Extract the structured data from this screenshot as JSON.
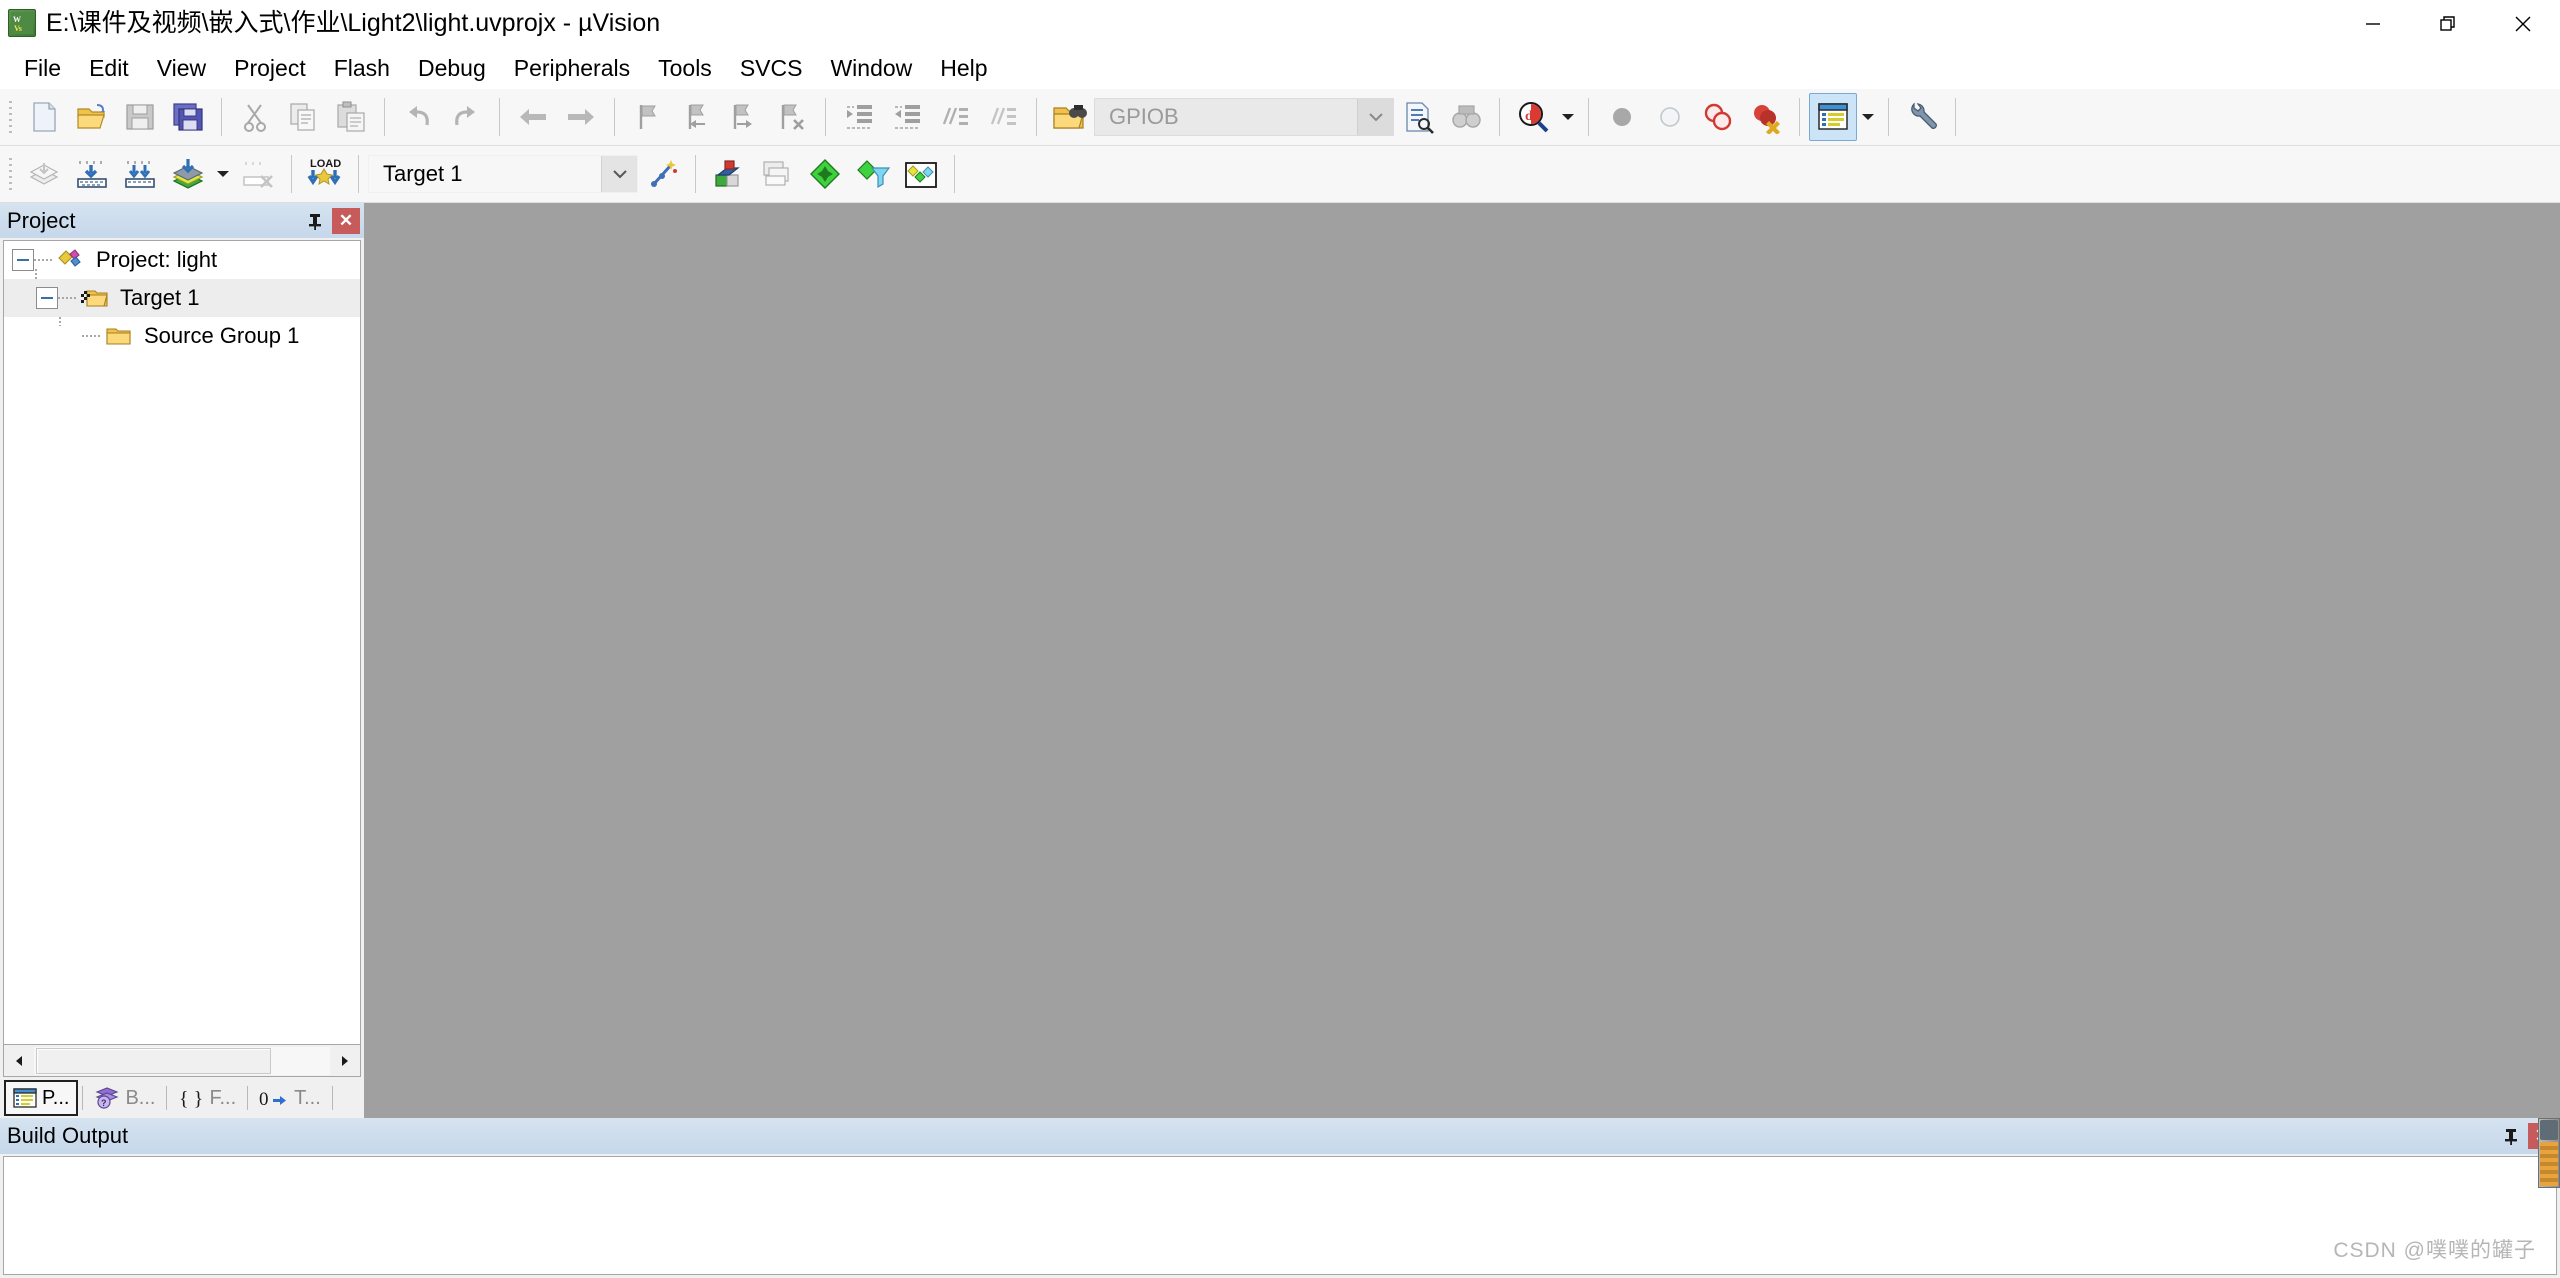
{
  "window": {
    "title": "E:\\课件及视频\\嵌入式\\作业\\Light2\\light.uvprojx - µVision",
    "app_icon": "uvision-logo-icon",
    "controls": {
      "minimize": "minimize-icon",
      "restore": "restore-icon",
      "close": "close-icon"
    },
    "accent_color": "#0072c6"
  },
  "menubar": {
    "items": [
      {
        "label": "File"
      },
      {
        "label": "Edit"
      },
      {
        "label": "View"
      },
      {
        "label": "Project"
      },
      {
        "label": "Flash"
      },
      {
        "label": "Debug"
      },
      {
        "label": "Peripherals"
      },
      {
        "label": "Tools"
      },
      {
        "label": "SVCS"
      },
      {
        "label": "Window"
      },
      {
        "label": "Help"
      }
    ]
  },
  "toolbar_file": {
    "buttons": [
      {
        "name": "new-file-button",
        "icon": "new-file-icon",
        "enabled": true
      },
      {
        "name": "open-file-button",
        "icon": "open-folder-icon",
        "enabled": true
      },
      {
        "name": "save-button",
        "icon": "save-disk-icon",
        "enabled": false
      },
      {
        "name": "save-all-button",
        "icon": "save-all-icon",
        "enabled": true
      },
      {
        "name": "cut-button",
        "icon": "scissors-icon",
        "enabled": false
      },
      {
        "name": "copy-button",
        "icon": "copy-icon",
        "enabled": false
      },
      {
        "name": "paste-button",
        "icon": "paste-icon",
        "enabled": false
      },
      {
        "name": "undo-button",
        "icon": "undo-arrow-icon",
        "enabled": false
      },
      {
        "name": "redo-button",
        "icon": "redo-arrow-icon",
        "enabled": false
      },
      {
        "name": "navigate-backward-button",
        "icon": "arrow-left-icon",
        "enabled": false
      },
      {
        "name": "navigate-forward-button",
        "icon": "arrow-right-icon",
        "enabled": false
      },
      {
        "name": "toggle-bookmark-button",
        "icon": "bookmark-icon",
        "enabled": false
      },
      {
        "name": "previous-bookmark-button",
        "icon": "bookmark-previous-icon",
        "enabled": false
      },
      {
        "name": "next-bookmark-button",
        "icon": "bookmark-next-icon",
        "enabled": false
      },
      {
        "name": "clear-bookmarks-button",
        "icon": "bookmark-clear-icon",
        "enabled": false
      },
      {
        "name": "indent-button",
        "icon": "indent-right-icon",
        "enabled": false
      },
      {
        "name": "outdent-button",
        "icon": "indent-left-icon",
        "enabled": false
      },
      {
        "name": "comment-button",
        "icon": "comment-lines-icon",
        "enabled": false
      },
      {
        "name": "uncomment-button",
        "icon": "uncomment-lines-icon",
        "enabled": false
      },
      {
        "name": "find-in-files-button",
        "icon": "folder-binoculars-icon",
        "enabled": true
      },
      {
        "name": "incremental-find-button",
        "icon": "document-find-icon",
        "enabled": true
      },
      {
        "name": "find-next-button",
        "icon": "binoculars-icon",
        "enabled": false
      },
      {
        "name": "debug-session-button",
        "icon": "debug-magnifier-icon",
        "enabled": true
      },
      {
        "name": "insert-breakpoint-button",
        "icon": "breakpoint-gray-icon",
        "enabled": false
      },
      {
        "name": "enable-breakpoint-button",
        "icon": "breakpoint-hollow-icon",
        "enabled": false
      },
      {
        "name": "disable-all-breakpoints-button",
        "icon": "breakpoints-red-icon",
        "enabled": true
      },
      {
        "name": "kill-all-breakpoints-button",
        "icon": "breakpoint-delete-icon",
        "enabled": true
      },
      {
        "name": "manage-windows-button",
        "icon": "window-layout-icon",
        "enabled": true
      },
      {
        "name": "configuration-wizard-button",
        "icon": "wrench-icon",
        "enabled": true
      }
    ],
    "search": {
      "name": "find-combo",
      "value": "GPIOB",
      "placeholder": "",
      "dropdown_icon": "chevron-down-icon"
    }
  },
  "toolbar_build": {
    "buttons": [
      {
        "name": "translate-file-button",
        "icon": "translate-icon",
        "enabled": false
      },
      {
        "name": "build-target-button",
        "icon": "build-icon",
        "enabled": true
      },
      {
        "name": "rebuild-all-button",
        "icon": "rebuild-all-icon",
        "enabled": true
      },
      {
        "name": "batch-build-button",
        "icon": "batch-build-icon",
        "enabled": true
      },
      {
        "name": "stop-build-button",
        "icon": "stop-build-icon",
        "enabled": false
      },
      {
        "name": "download-button",
        "icon": "load-download-icon",
        "enabled": true
      },
      {
        "name": "target-options-button",
        "icon": "target-options-wand-icon",
        "enabled": true
      },
      {
        "name": "options-for-target-button",
        "icon": "options-target-icon",
        "enabled": true
      },
      {
        "name": "manage-project-items-button",
        "icon": "manage-items-icon",
        "enabled": false
      },
      {
        "name": "pack-installer-button",
        "icon": "green-diamond-icon",
        "enabled": true
      },
      {
        "name": "manage-run-time-environment-button",
        "icon": "funnel-diamond-icon",
        "enabled": true
      },
      {
        "name": "select-software-packs-button",
        "icon": "software-packs-icon",
        "enabled": true
      }
    ],
    "target_select": {
      "name": "target-combo",
      "value": "Target 1",
      "dropdown_icon": "chevron-down-icon"
    }
  },
  "project_panel": {
    "title": "Project",
    "pin_icon": "pin-icon",
    "close_icon": "close-icon",
    "tree": [
      {
        "label": "Project: light",
        "icon": "project-icon",
        "level": 0,
        "expanded": true,
        "selected": false
      },
      {
        "label": "Target 1",
        "icon": "target-folder-icon",
        "level": 1,
        "expanded": true,
        "selected": true
      },
      {
        "label": "Source Group 1",
        "icon": "folder-icon",
        "level": 2,
        "expanded": null,
        "selected": false
      }
    ],
    "scrollbar": {
      "left_arrow": "arrow-left-icon",
      "right_arrow": "arrow-right-icon"
    },
    "tabs": [
      {
        "label": "P...",
        "full": "Project",
        "icon": "project-window-icon",
        "active": true
      },
      {
        "label": "B...",
        "full": "Books",
        "icon": "books-icon",
        "active": false
      },
      {
        "label": "F...",
        "full": "Functions",
        "icon": "braces-icon",
        "active": false
      },
      {
        "label": "T...",
        "full": "Templates",
        "icon": "templates-icon",
        "active": false
      }
    ]
  },
  "build_output": {
    "title": "Build Output",
    "pin_icon": "pin-icon",
    "close_icon": "close-icon",
    "content": ""
  },
  "watermark": {
    "text": "CSDN @噗噗的罐子"
  }
}
